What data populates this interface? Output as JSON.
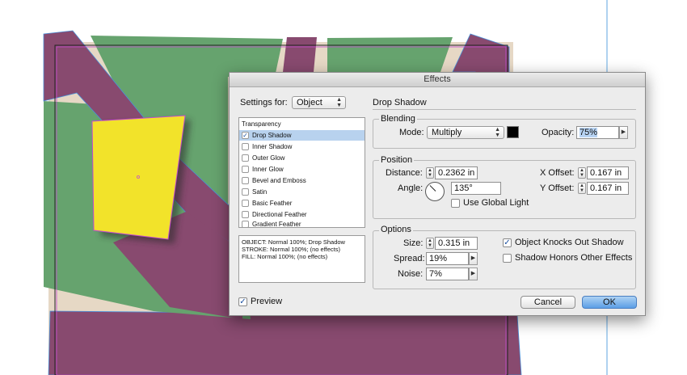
{
  "colors": {
    "purple": "#884a6f",
    "green": "#66a36e",
    "beige": "#e6d8c5",
    "yellow": "#f2e32a",
    "accent": "#4a7fc1"
  },
  "dialog": {
    "title": "Effects",
    "settings_for_label": "Settings for:",
    "settings_for_value": "Object",
    "section_title": "Drop Shadow",
    "effects_list_header": "Transparency",
    "effects_list": [
      {
        "label": "Drop Shadow",
        "checked": true,
        "selected": true
      },
      {
        "label": "Inner Shadow",
        "checked": false
      },
      {
        "label": "Outer Glow",
        "checked": false
      },
      {
        "label": "Inner Glow",
        "checked": false
      },
      {
        "label": "Bevel and Emboss",
        "checked": false
      },
      {
        "label": "Satin",
        "checked": false
      },
      {
        "label": "Basic Feather",
        "checked": false
      },
      {
        "label": "Directional Feather",
        "checked": false
      },
      {
        "label": "Gradient Feather",
        "checked": false
      }
    ],
    "summary": [
      "OBJECT: Normal 100%; Drop Shadow",
      "STROKE: Normal 100%; (no effects)",
      "FILL: Normal 100%; (no effects)"
    ],
    "blending": {
      "title": "Blending",
      "mode_label": "Mode:",
      "mode_value": "Multiply",
      "opacity_label": "Opacity:",
      "opacity_value": "75%"
    },
    "position": {
      "title": "Position",
      "distance_label": "Distance:",
      "distance_value": "0.2362 in",
      "angle_label": "Angle:",
      "angle_value": "135°",
      "use_global_light_label": "Use Global Light",
      "use_global_light_checked": false,
      "x_offset_label": "X Offset:",
      "x_offset_value": "0.167 in",
      "y_offset_label": "Y Offset:",
      "y_offset_value": "0.167 in"
    },
    "options": {
      "title": "Options",
      "size_label": "Size:",
      "size_value": "0.315 in",
      "spread_label": "Spread:",
      "spread_value": "19%",
      "noise_label": "Noise:",
      "noise_value": "7%",
      "knocks_out_label": "Object Knocks Out Shadow",
      "knocks_out_checked": true,
      "honors_label": "Shadow Honors Other Effects",
      "honors_checked": false
    },
    "preview_label": "Preview",
    "preview_checked": true,
    "cancel_label": "Cancel",
    "ok_label": "OK"
  }
}
